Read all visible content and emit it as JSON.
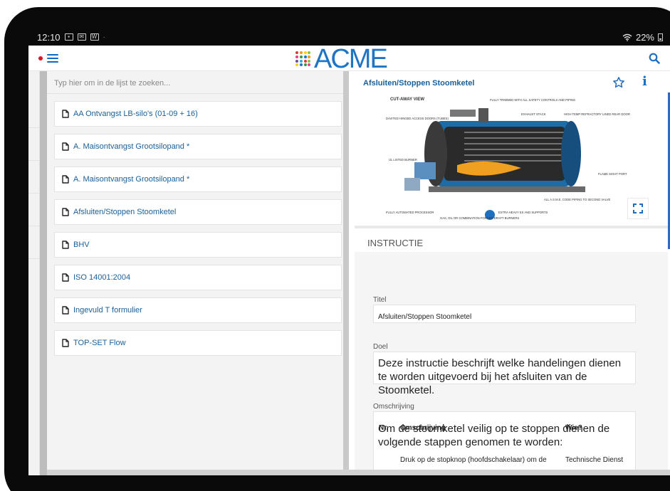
{
  "statusbar": {
    "time": "12:10",
    "notification_icons": [
      "image-icon",
      "mail-icon",
      "word-icon"
    ],
    "battery": "22%"
  },
  "header": {
    "logo_text": "ACME",
    "brand_color": "#1f74c4",
    "recording_color": "#e0141e"
  },
  "list": {
    "search_placeholder": "Typ hier om in de lijst te zoeken...",
    "items": [
      {
        "label": "AA Ontvangst LB-silo's (01-09 + 16)",
        "icon": "document-icon"
      },
      {
        "label": "A. Maisontvangst Grootsilopand *",
        "icon": "document-icon"
      },
      {
        "label": "A. Maisontvangst Grootsilopand *",
        "icon": "document-icon"
      },
      {
        "label": "Afsluiten/Stoppen Stoomketel",
        "icon": "document-icon"
      },
      {
        "label": "BHV",
        "icon": "document-icon"
      },
      {
        "label": "ISO 14001:2004",
        "icon": "document-icon"
      },
      {
        "label": "Ingevuld T formulier",
        "icon": "document-icon"
      },
      {
        "label": "TOP-SET Flow",
        "icon": "document-icon"
      }
    ]
  },
  "detail": {
    "title": "Afsluiten/Stoppen Stoomketel",
    "figure": {
      "heading": "CUT-AWAY VIEW",
      "callouts": [
        "FULLY TRIMMED WITH ALL SAFETY CONTROLS AND PIPING",
        "DAVITED HINGED ACCESS DOORS (TUBES)",
        "EXHAUST STACK",
        "HIGH TEMP REFRACTORY LINED REAR DOOR",
        "UL LISTED BURNER",
        "FLAME SIGHT PORT",
        "ALL A.S.M.E. CODE PIPING TO SECOND VALVE",
        "FULLY AUTOMATED PROCESSOR",
        "GAS, OIL OR COMBINATION FORCED DRAFT BURNERS",
        "EXTRA HEAVY ES AND SUPPORTS"
      ]
    },
    "section_heading": "INSTRUCTIE",
    "fields": {
      "titel_label": "Titel",
      "titel_value": "Afsluiten/Stoppen Stoomketel",
      "doel_label": "Doel",
      "doel_value": "Deze instructie beschrijft welke handelingen dienen te worden uitgevoerd bij het afsluiten van de Stoomketel.",
      "omschrijving_label": "Omschrijving",
      "omschrijving_value": "Om de stoomketel veilig op te stoppen dienen de volgende stappen genomen te worden:"
    },
    "table": {
      "headers": {
        "nr": "Nr.",
        "desc": "Omschrijving",
        "who": "Wie?"
      },
      "rows": [
        {
          "nr": "",
          "desc": "Druk op de stopknop (hoofdschakelaar) om de",
          "who": "Technische Dienst"
        }
      ]
    }
  }
}
